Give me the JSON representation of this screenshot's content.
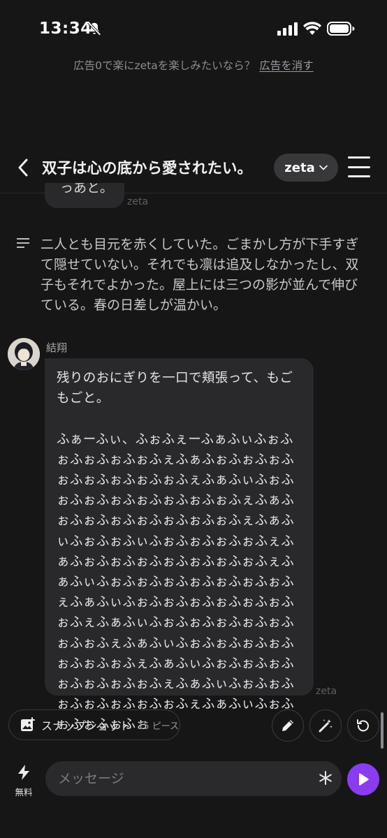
{
  "status_bar": {
    "time": "13:34",
    "icons": [
      "bell-off-icon",
      "signal-icon",
      "wifi-icon",
      "battery-icon"
    ]
  },
  "ad_banner": {
    "text": "広告0で楽にzetaを楽しみたいなら？",
    "link": "広告を消す"
  },
  "header": {
    "title": "双子は心の底から愛されたい。",
    "model_button": "zeta"
  },
  "previous_message": {
    "text_fragment": "っあと。",
    "sender": "zeta"
  },
  "narration": {
    "text": "二人とも目元を赤くしていた。ごまかし方が下手すぎて隠せていない。それでも凛は追及しなかったし、双子もそれでよかった。屋上には三つの影が並んで伸びている。春の日差しが温かい。"
  },
  "message": {
    "sender_name": "結翔",
    "text": "残りのおにぎりを一口で頬張って、もごもごと。\n\nふぁーふぃ、ふぉふぇーふぁふぃふぉふぉふぉふぉふぉふぇふぁふぉふぉふぉふぉふぉふぉふぉふぉふぇふぁふぃふぉふぉふぉふぉふぉふぉふぉふぉふぇふぁふぉふぉふぉふぉふぉふぉふぉふぇふぁふぃふぉふぉふぃふぉふぉふぉふぉふぇふぁふぉふぉふぉふぉふぉふぉふぉふぇふぁふぃふぉふぉふぉふぉふぉふぉふぉふぇふぁふぃふぉふぉふぉふぉふぉふぉふぉふぇふぁふぃふぉふぉふぉふぉふぉふぉふぉふぇふぁふぃふぉふぉふぉふぉふぉふぉふぉふぇふぁふぃふぉふぉふぉふぉふぉふぉふぉふぇふぁふぃふぉふぉふぉふぉふぉふぉふぉふぇふぁふぃふぉふぉふぉふぉふぉ",
    "reply_sender": "zeta"
  },
  "actions": {
    "snapshot_label": "スナップショット",
    "snapshot_count": "15 ピース",
    "buttons": [
      "pencil-icon",
      "magic-wand-icon",
      "regenerate-icon"
    ]
  },
  "input": {
    "free_label": "無料",
    "placeholder": "メッセージ"
  },
  "colors": {
    "background": "#161617",
    "bubble": "#29292c",
    "accent": "#8a3cf0"
  }
}
